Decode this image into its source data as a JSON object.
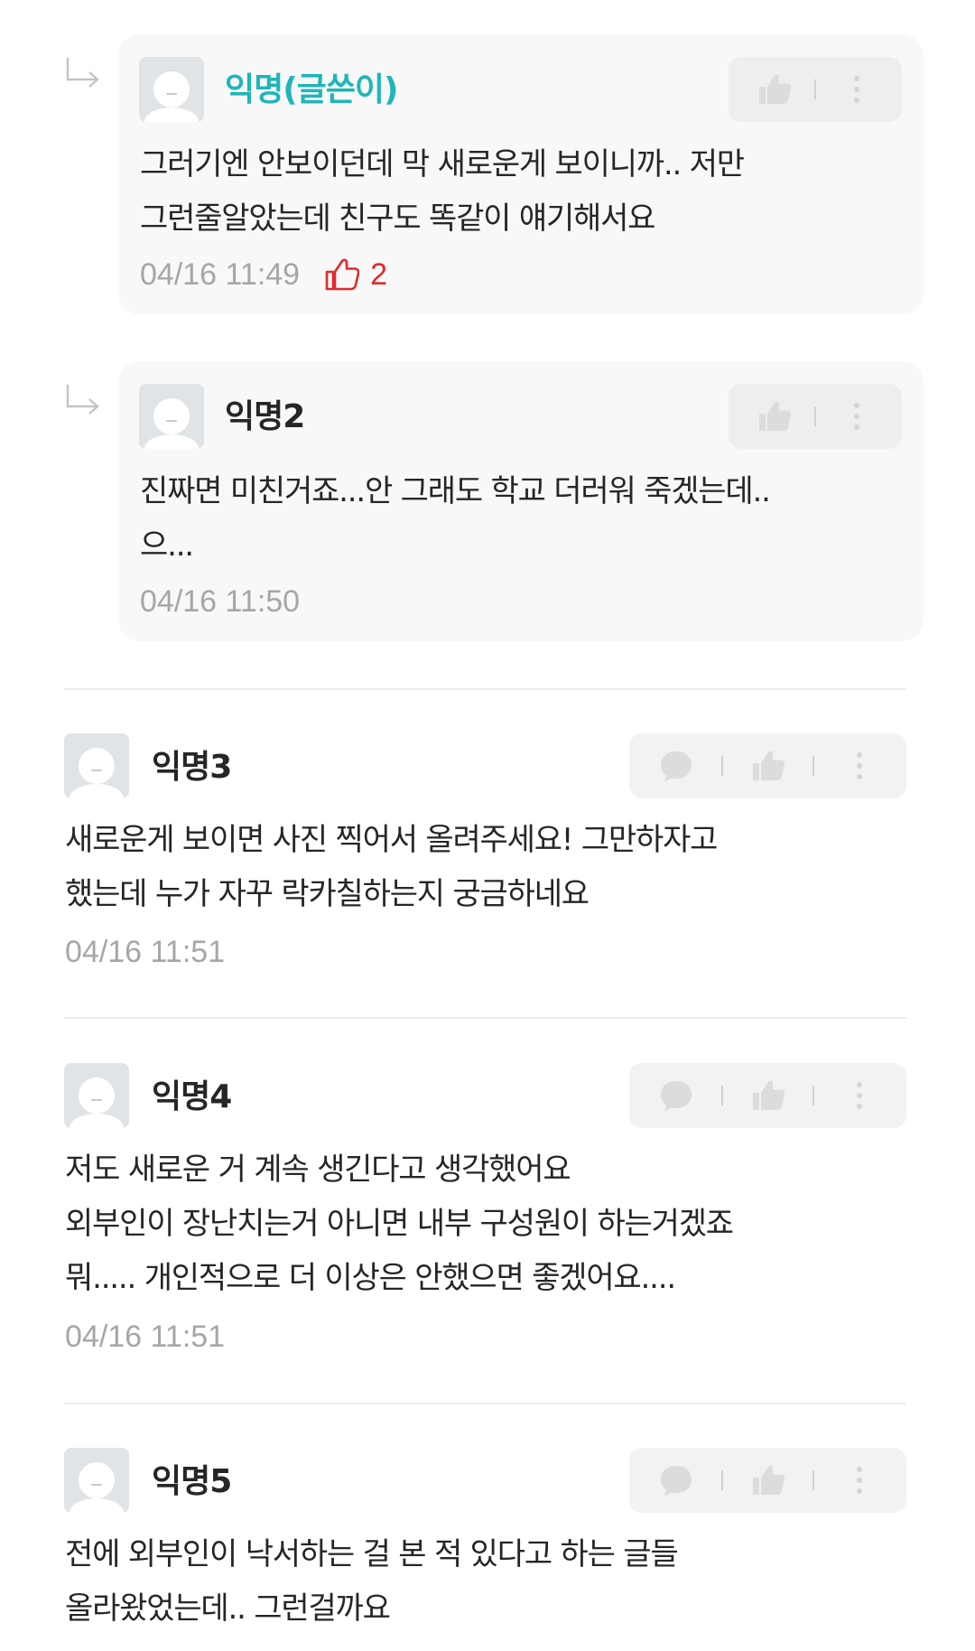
{
  "comments": [
    {
      "nickname": "익명(글쓴이)",
      "lines": [
        "그러기엔 안보이던데 막 새로운게 보이니까.. 저만",
        "그런줄알았는데 친구도 똑같이 얘기해서요"
      ],
      "time": "04/16 11:49",
      "likes": "2"
    },
    {
      "nickname": "익명2",
      "lines": [
        "진짜면 미친거죠...안 그래도 학교 더러워 죽겠는데..",
        "으..."
      ],
      "time": "04/16 11:50"
    },
    {
      "nickname": "익명3",
      "lines": [
        "새로운게 보이면 사진 찍어서 올려주세요! 그만하자고",
        "했는데 누가 자꾸 락카칠하는지 궁금하네요"
      ],
      "time": "04/16 11:51"
    },
    {
      "nickname": "익명4",
      "lines": [
        "저도 새로운 거 계속 생긴다고 생각했어요",
        "외부인이 장난치는거 아니면 내부 구성원이 하는거겠죠",
        "뭐..... 개인적으로 더 이상은 안했으면 좋겠어요...."
      ],
      "time": "04/16 11:51"
    },
    {
      "nickname": "익명5",
      "lines": [
        "전에 외부인이 낙서하는 걸 본 적 있다고 하는 글들",
        "올라왔었는데.. 그런걸까요"
      ]
    }
  ],
  "icons": {
    "reply_arrow": "reply-arrow-icon",
    "avatar": "default-avatar-icon",
    "like": "thumbs-up-icon",
    "reply": "speech-bubble-icon",
    "more": "more-vertical-icon",
    "like_count": "thumbs-up-outline-icon"
  },
  "colors": {
    "author_nickname": "#1fb6b8",
    "like_count": "#e02a2a",
    "meta_text": "#a6a6a6",
    "reply_bg": "#f8f8f8"
  }
}
